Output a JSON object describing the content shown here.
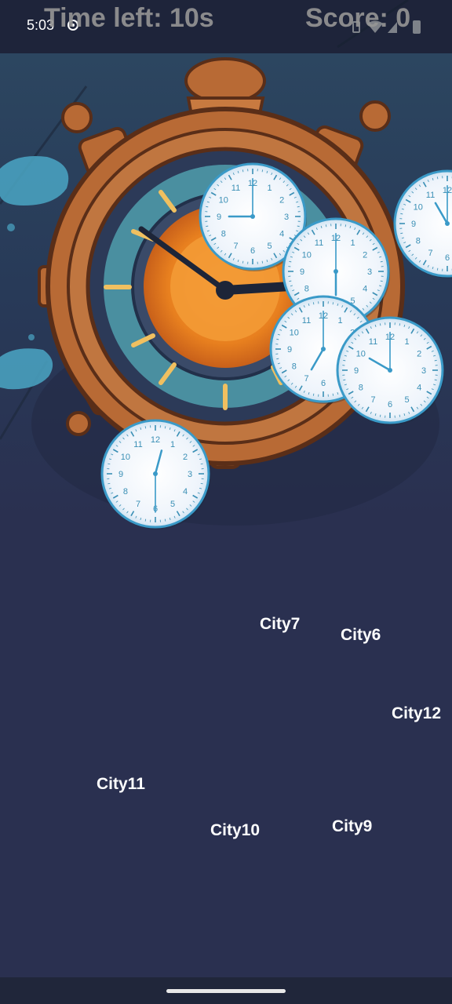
{
  "status_bar": {
    "time": "5:03",
    "icons": [
      "vibrate-icon",
      "wifi-icon",
      "signal-icon",
      "battery-icon"
    ]
  },
  "hud": {
    "time_left": "Time left: 10s",
    "score": "Score: 0"
  },
  "cities": [
    {
      "id": "city7",
      "label": "City7"
    },
    {
      "id": "city6",
      "label": "City6"
    },
    {
      "id": "city12",
      "label": "City12"
    },
    {
      "id": "city11",
      "label": "City11"
    },
    {
      "id": "city10",
      "label": "City10"
    },
    {
      "id": "city9",
      "label": "City9"
    }
  ],
  "clocks": [
    {
      "id": "clock-1",
      "hour": 9,
      "minute": 0
    },
    {
      "id": "clock-2",
      "hour": 6,
      "minute": 0
    },
    {
      "id": "clock-3",
      "hour": 7,
      "minute": 0
    },
    {
      "id": "clock-4",
      "hour": 10,
      "minute": 0
    },
    {
      "id": "clock-5",
      "hour": 12,
      "minute": 30
    },
    {
      "id": "clock-6",
      "hour": 11,
      "minute": 0
    }
  ],
  "colors": {
    "background": "#2a3050",
    "clock_face": "#eef4fb",
    "clock_rim": "#3a9ac8",
    "clock_numerals": "#3a8fb5",
    "wood": "#b86a35",
    "dial_orange": "#f08a2a",
    "roman_gold": "#f0c060"
  }
}
